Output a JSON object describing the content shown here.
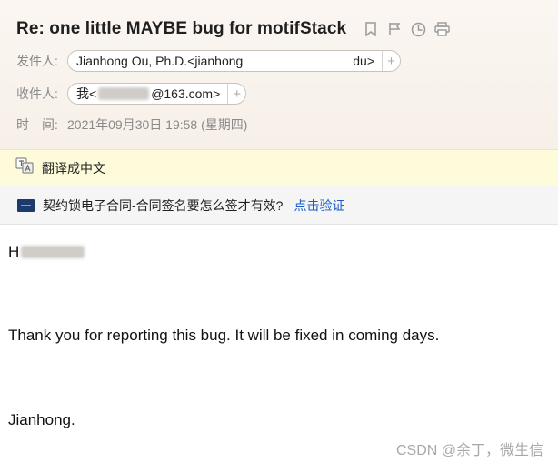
{
  "subject": "Re: one little MAYBE bug for motifStack",
  "icons": [
    "bookmark-icon",
    "flag-icon",
    "clock-icon",
    "print-icon"
  ],
  "from": {
    "label": "发件人:",
    "name": "Jianhong Ou, Ph.D.<jianhong",
    "suffix": "du>",
    "add": "+"
  },
  "to": {
    "label": "收件人:",
    "prefix": "我<",
    "suffix": "@163.com>",
    "add": "+"
  },
  "time": {
    "label": "时　间:",
    "value": "2021年09月30日 19:58 (星期四)"
  },
  "translate": {
    "label": "翻译成中文"
  },
  "ad": {
    "text": "契约锁电子合同-合同签名要怎么签才有效?",
    "link": "点击验证"
  },
  "body": {
    "greeting": "H",
    "line1": "Thank you for reporting this bug. It will be fixed in coming days.",
    "signature": "Jianhong."
  },
  "watermark": "CSDN @余丁，微生信"
}
